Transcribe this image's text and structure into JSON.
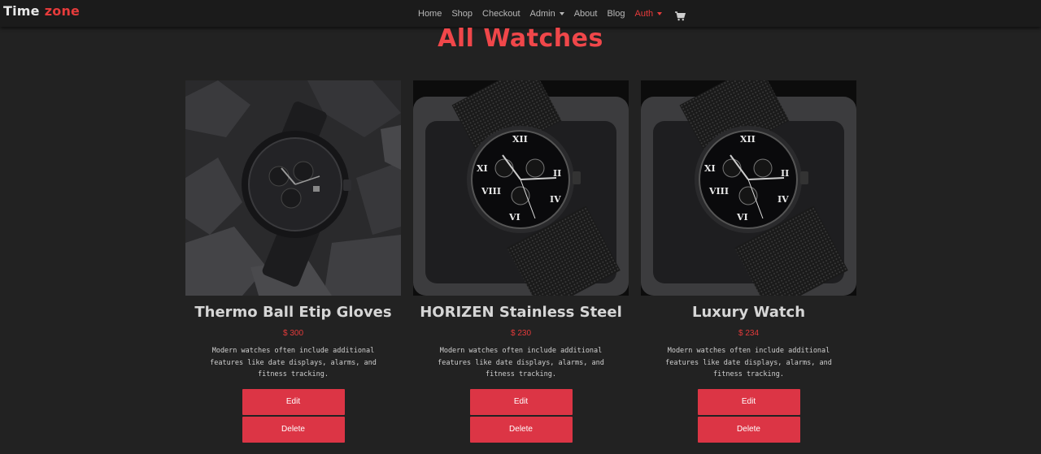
{
  "brand": {
    "part1": "Time",
    "part2": "zone"
  },
  "nav": {
    "home": "Home",
    "shop": "Shop",
    "checkout": "Checkout",
    "admin": "Admin",
    "about": "About",
    "blog": "Blog",
    "auth": "Auth"
  },
  "page_title": "All Watches",
  "products": [
    {
      "title": "Thermo Ball Etip Gloves",
      "price": "$ 300",
      "description": "Modern watches often include additional features like date displays, alarms, and fitness tracking.",
      "edit_label": "Edit",
      "delete_label": "Delete"
    },
    {
      "title": "HORIZEN Stainless Steel",
      "price": "$ 230",
      "description": "Modern watches often include additional features like date displays, alarms, and fitness tracking.",
      "edit_label": "Edit",
      "delete_label": "Delete"
    },
    {
      "title": "Luxury Watch",
      "price": "$ 234",
      "description": "Modern watches often include additional features like date displays, alarms, and fitness tracking.",
      "edit_label": "Edit",
      "delete_label": "Delete"
    }
  ],
  "colors": {
    "accent": "#dc3545",
    "brand_red": "#e53b3b",
    "background": "#222222",
    "navbar": "#1b1b1b"
  },
  "icons": {
    "cart": "shopping-cart-icon"
  }
}
